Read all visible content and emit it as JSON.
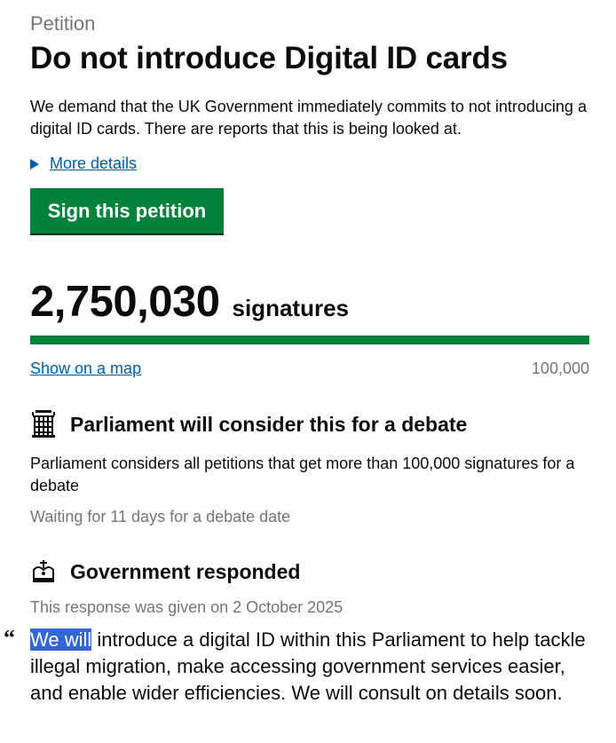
{
  "petition": {
    "caption": "Petition",
    "title": "Do not introduce Digital ID cards",
    "description": "We demand that the UK Government immediately commits to not introducing a digital ID cards. There are reports that this is being looked at.",
    "more_details_label": "More details",
    "sign_button_label": "Sign this petition"
  },
  "signatures": {
    "count": "2,750,030",
    "label": "signatures",
    "show_map_label": "Show on a map",
    "threshold_label": "100,000",
    "progress_fraction": 1.0
  },
  "debate": {
    "icon": "portcullis-icon",
    "heading": "Parliament will consider this for a debate",
    "text": "Parliament considers all petitions that get more than 100,000 signatures for a debate",
    "status": "Waiting for 11 days for a debate date"
  },
  "response": {
    "icon": "crown-icon",
    "heading": "Government responded",
    "date_text": "This response was given on 2 October 2025",
    "quote_mark": "“",
    "quote_selected": "We will",
    "quote_rest": " introduce a digital ID within this Parliament to help tackle illegal migration, make accessing government services easier, and enable wider efficiencies. We will consult on details soon."
  },
  "colors": {
    "accent_green": "#00823b",
    "link_blue": "#005ea5",
    "muted_grey": "#6f777b",
    "selection_blue": "#3367d6"
  }
}
